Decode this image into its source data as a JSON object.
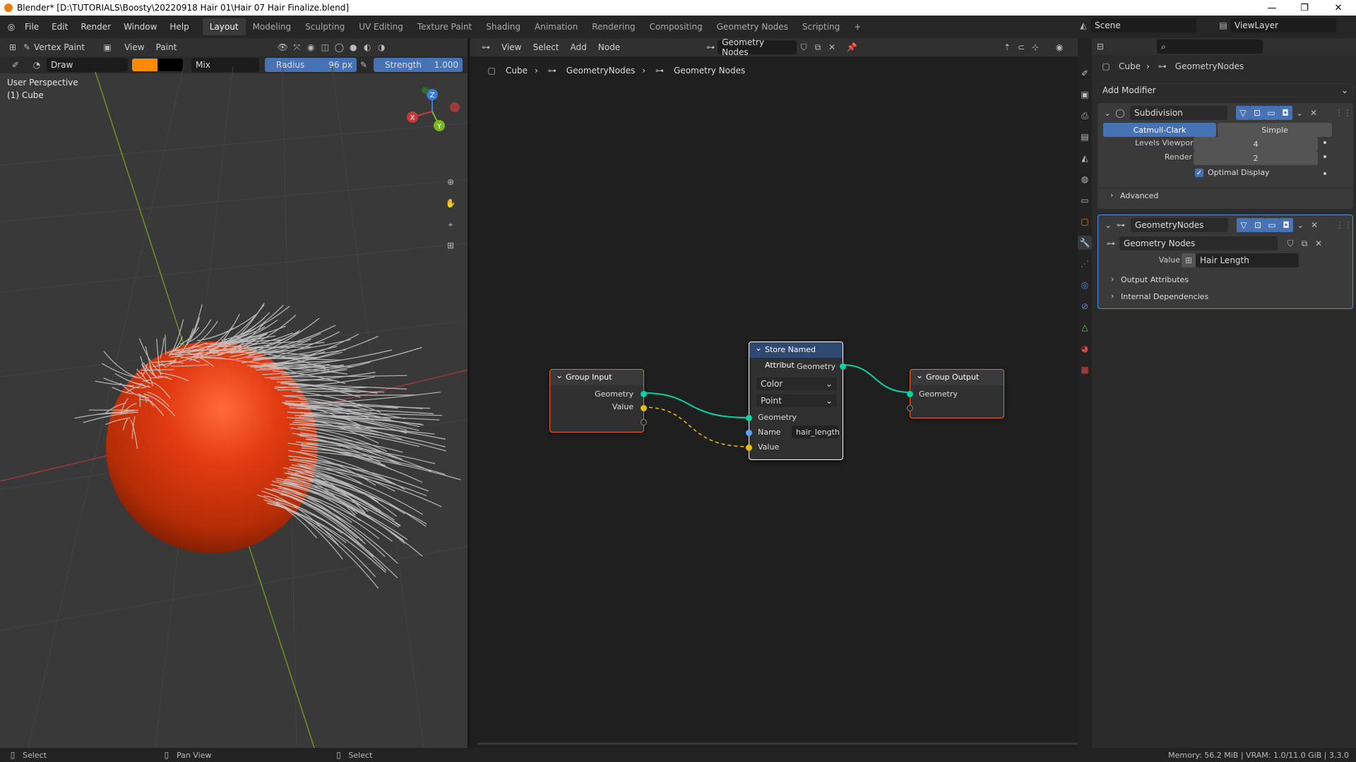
{
  "window": {
    "title": "Blender* [D:\\TUTORIALS\\Boosty\\20220918 Hair 01\\Hair 07 Hair Finalize.blend]",
    "minimize": "—",
    "maximize": "❐",
    "close": "✕"
  },
  "menu": [
    "File",
    "Edit",
    "Render",
    "Window",
    "Help"
  ],
  "workspaces": [
    "Layout",
    "Modeling",
    "Sculpting",
    "UV Editing",
    "Texture Paint",
    "Shading",
    "Animation",
    "Rendering",
    "Compositing",
    "Geometry Nodes",
    "Scripting",
    "+"
  ],
  "active_workspace": "Layout",
  "scene": {
    "label": "Scene"
  },
  "view_layer": {
    "label": "ViewLayer"
  },
  "viewport": {
    "mode": "Vertex Paint",
    "menus": [
      "View",
      "Paint"
    ],
    "brush": "Draw",
    "blend": "Mix",
    "radius_label": "Radius",
    "radius_value": "96 px",
    "strength_label": "Strength",
    "strength_value": "1.000",
    "strength_fill": 1.0,
    "overlay_title": "User Perspective",
    "overlay_object": "(1) Cube",
    "primary_color": "#ff8c00",
    "secondary_color": "#000000",
    "gizmo": {
      "x": "X",
      "y": "Y",
      "z": "Z"
    }
  },
  "node_editor": {
    "menus": [
      "View",
      "Select",
      "Add",
      "Node"
    ],
    "tree_name": "Geometry Nodes",
    "breadcrumb": [
      "Cube",
      "GeometryNodes",
      "Geometry Nodes"
    ],
    "nodes": {
      "group_input": {
        "title": "Group Input",
        "outputs": [
          "Geometry",
          "Value"
        ]
      },
      "store": {
        "title": "Store Named Attribut",
        "out_geometry": "Geometry",
        "data_type": "Color",
        "domain": "Point",
        "in_geometry": "Geometry",
        "name_label": "Name",
        "name_value": "hair_length",
        "in_value": "Value"
      },
      "group_output": {
        "title": "Group Output",
        "inputs": [
          "Geometry"
        ]
      }
    }
  },
  "properties": {
    "breadcrumb": [
      "Cube",
      "GeometryNodes"
    ],
    "add_modifier": "Add Modifier",
    "subdivision": {
      "name": "Subdivision",
      "catmull": "Catmull-Clark",
      "simple": "Simple",
      "levels_label": "Levels Viewport",
      "levels_value": "4",
      "render_label": "Render",
      "render_value": "2",
      "optimal_label": "Optimal Display",
      "optimal_checked": true,
      "advanced": "Advanced"
    },
    "geonodes": {
      "name": "GeometryNodes",
      "tree": "Geometry Nodes",
      "value_label": "Value",
      "value_attr": "Hair Length",
      "output_attrs": "Output Attributes",
      "internal_deps": "Internal Dependencies"
    }
  },
  "status": {
    "left": "Select",
    "mid": "Pan View",
    "right": "Select",
    "memory": "Memory: 56.2 MiB | VRAM: 1.0/11.0 GiB | 3.3.0"
  }
}
